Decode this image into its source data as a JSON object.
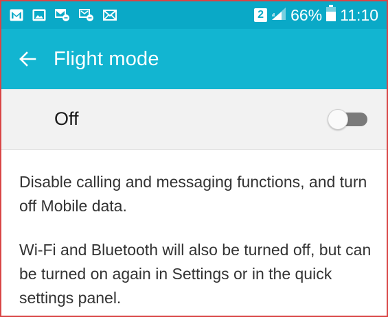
{
  "status_bar": {
    "sim_slot": "2",
    "battery_percent": "66%",
    "time": "11:10",
    "notification_icons": [
      "gmail-icon",
      "gallery-icon",
      "missed-call-icon",
      "missed-call-icon",
      "message-icon"
    ]
  },
  "app_bar": {
    "title": "Flight mode",
    "back_icon": "arrow-left-icon"
  },
  "toggle": {
    "label": "Off",
    "state": false
  },
  "description": {
    "para1": "Disable calling and messaging functions, and turn off Mobile data.",
    "para2": "Wi-Fi and Bluetooth will also be turned off, but can be turned on again in Settings or in the quick settings panel."
  },
  "colors": {
    "status_bar": "#0aa9c7",
    "app_bar": "#12b5d1",
    "frame_border": "#d94545"
  }
}
